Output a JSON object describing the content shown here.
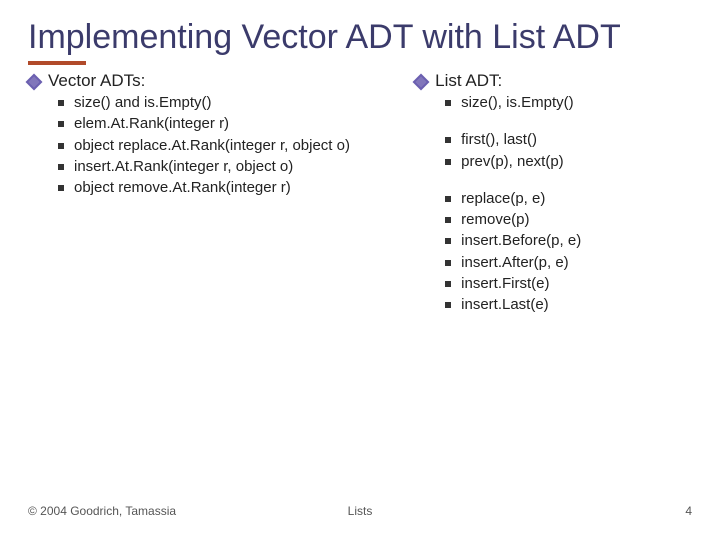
{
  "title": "Implementing Vector ADT with List ADT",
  "left": {
    "heading": "Vector ADTs:",
    "items": [
      "size() and is.Empty()",
      "elem.At.Rank(integer r)",
      "object replace.At.Rank(integer r, object o)",
      "insert.At.Rank(integer r, object o)",
      "object remove.At.Rank(integer r)"
    ]
  },
  "right": {
    "heading": "List ADT:",
    "group1": [
      "size(), is.Empty()"
    ],
    "group2": [
      "first(), last()",
      "prev(p), next(p)"
    ],
    "group3": [
      "replace(p, e)",
      "remove(p)",
      "insert.Before(p, e)",
      "insert.After(p, e)",
      "insert.First(e)",
      "insert.Last(e)"
    ]
  },
  "footer": {
    "left": "© 2004 Goodrich, Tamassia",
    "center": "Lists",
    "right": "4"
  }
}
